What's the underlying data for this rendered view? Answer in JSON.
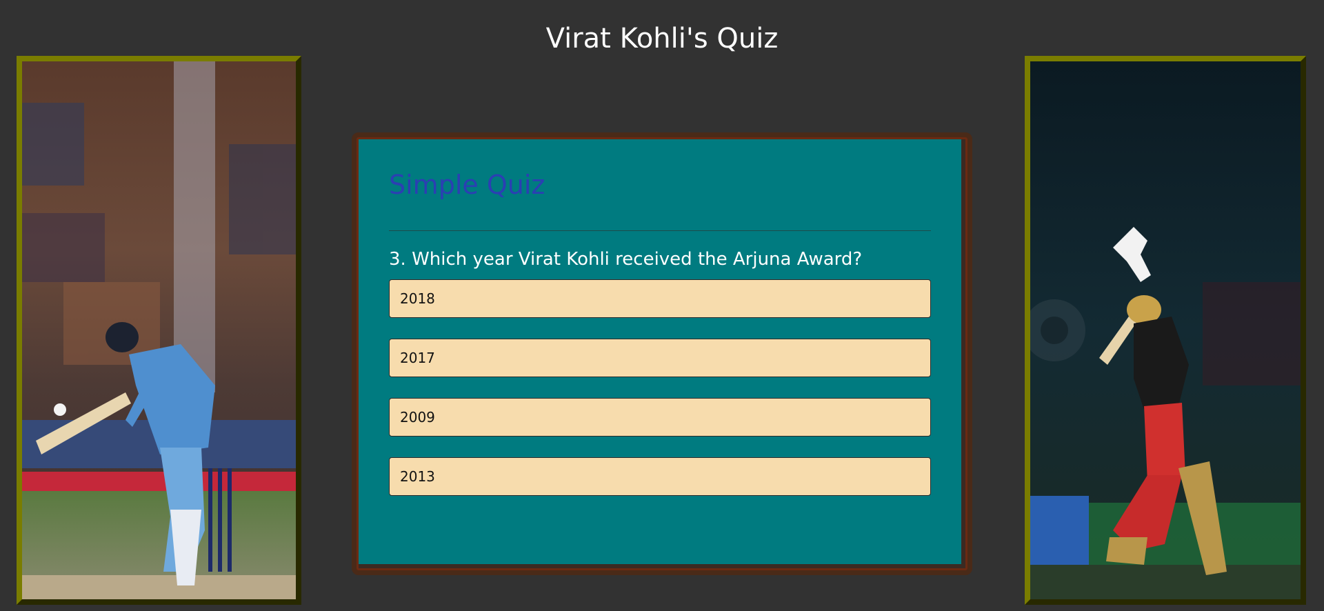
{
  "page": {
    "title": "Virat Kohli's Quiz"
  },
  "quiz": {
    "heading": "Simple Quiz",
    "question": "3. Which year Virat Kohli received the Arjuna Award?",
    "options": [
      {
        "label": "2018"
      },
      {
        "label": "2017"
      },
      {
        "label": "2009"
      },
      {
        "label": "2013"
      }
    ]
  },
  "colors": {
    "background": "#323232",
    "frame": "#7a7d00",
    "card": "#007b80",
    "card_border": "#6b2a12",
    "heading": "#2b3fb3",
    "option_bg": "#f7dcad"
  },
  "images": {
    "left": "batsman-blue-kit-photo",
    "right": "batsman-red-kit-photo"
  }
}
